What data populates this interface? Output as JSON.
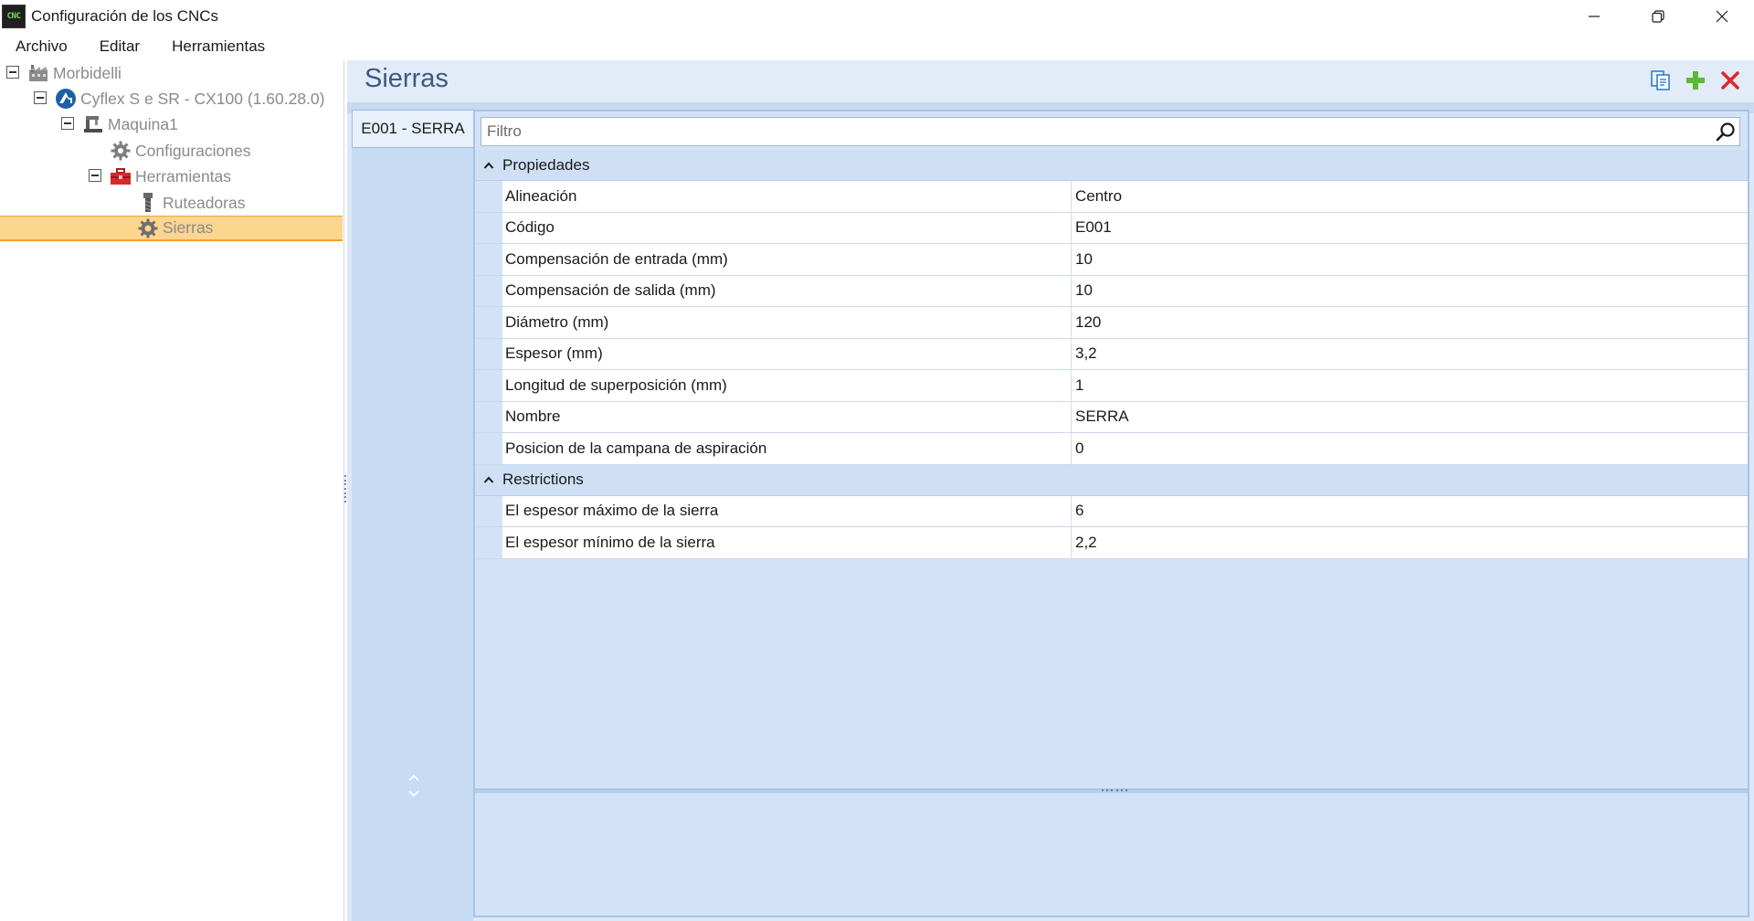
{
  "window": {
    "icon_text": "CNC",
    "title": "Configuración de los CNCs",
    "icons": [
      "minimize-icon",
      "restore-icon",
      "close-icon"
    ]
  },
  "menu": {
    "items": [
      "Archivo",
      "Editar",
      "Herramientas"
    ]
  },
  "tree": {
    "nodes": [
      {
        "label": "Morbidelli",
        "icon": "factory-icon",
        "expanded": true
      },
      {
        "label": "Cyflex S e SR - CX100 (1.60.28.0)",
        "icon": "machine-brand-icon",
        "expanded": true
      },
      {
        "label": "Maquina1",
        "icon": "machine-icon",
        "expanded": true
      },
      {
        "label": "Configuraciones",
        "icon": "gear-icon"
      },
      {
        "label": "Herramientas",
        "icon": "toolbox-icon",
        "expanded": true
      },
      {
        "label": "Ruteadoras",
        "icon": "router-bit-icon"
      },
      {
        "label": "Sierras",
        "icon": "saw-blade-icon",
        "selected": true
      }
    ]
  },
  "page": {
    "title": "Sierras",
    "actions": [
      "copy-icon",
      "add-icon",
      "delete-icon"
    ]
  },
  "items": {
    "list": [
      "E001 - SERRA"
    ]
  },
  "grid": {
    "filter_placeholder": "Filtro",
    "categories": [
      {
        "name": "Propiedades",
        "rows": [
          {
            "name": "Alineación",
            "value": "Centro"
          },
          {
            "name": "Código",
            "value": "E001"
          },
          {
            "name": "Compensación de entrada (mm)",
            "value": "10"
          },
          {
            "name": "Compensación de salida (mm)",
            "value": "10"
          },
          {
            "name": "Diámetro (mm)",
            "value": "120"
          },
          {
            "name": "Espesor (mm)",
            "value": "3,2"
          },
          {
            "name": "Longitud de superposición (mm)",
            "value": "1"
          },
          {
            "name": "Nombre",
            "value": "SERRA"
          },
          {
            "name": "Posicion de la campana de aspiración",
            "value": "0"
          }
        ]
      },
      {
        "name": "Restrictions",
        "rows": [
          {
            "name": "El espesor máximo de la sierra",
            "value": "6"
          },
          {
            "name": "El espesor mínimo de la sierra",
            "value": "2,2"
          }
        ]
      }
    ]
  },
  "colors": {
    "selection_fill": "#fcd58f",
    "selection_border": "#f0a22e",
    "title_blue": "#3d5a80",
    "add_green": "#5fb832",
    "delete_red": "#e0262a"
  }
}
